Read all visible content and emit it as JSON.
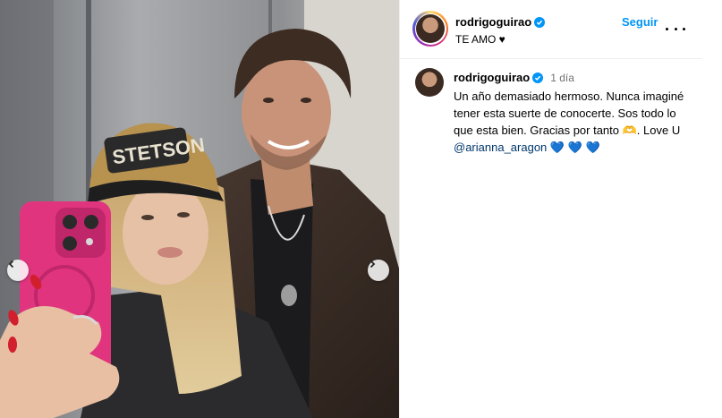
{
  "post": {
    "username": "rodrigoguirao",
    "header_subtitle": "TE AMO ♥",
    "follow_label": "Seguir",
    "caption": {
      "username": "rodrigoguirao",
      "time": "1 día",
      "text_before_mention": "Un año demasiado hermoso. Nunca imaginé tener esta suerte de conocerte. Sos todo lo que esta bien. Gracias por tanto 🫶. Love U ",
      "mention": "@arianna_aragon",
      "text_after_mention": " 💙 💙 💙"
    },
    "photo_cap_text": "STETSON"
  },
  "colors": {
    "link_blue": "#0095f6",
    "mention_blue": "#00376b",
    "verified_blue": "#0095f6",
    "timestamp_gray": "#737373"
  },
  "icons": {
    "verified": "verified-badge-icon",
    "more": "more-horizontal-icon",
    "prev": "chevron-left-icon",
    "next": "chevron-right-icon"
  }
}
